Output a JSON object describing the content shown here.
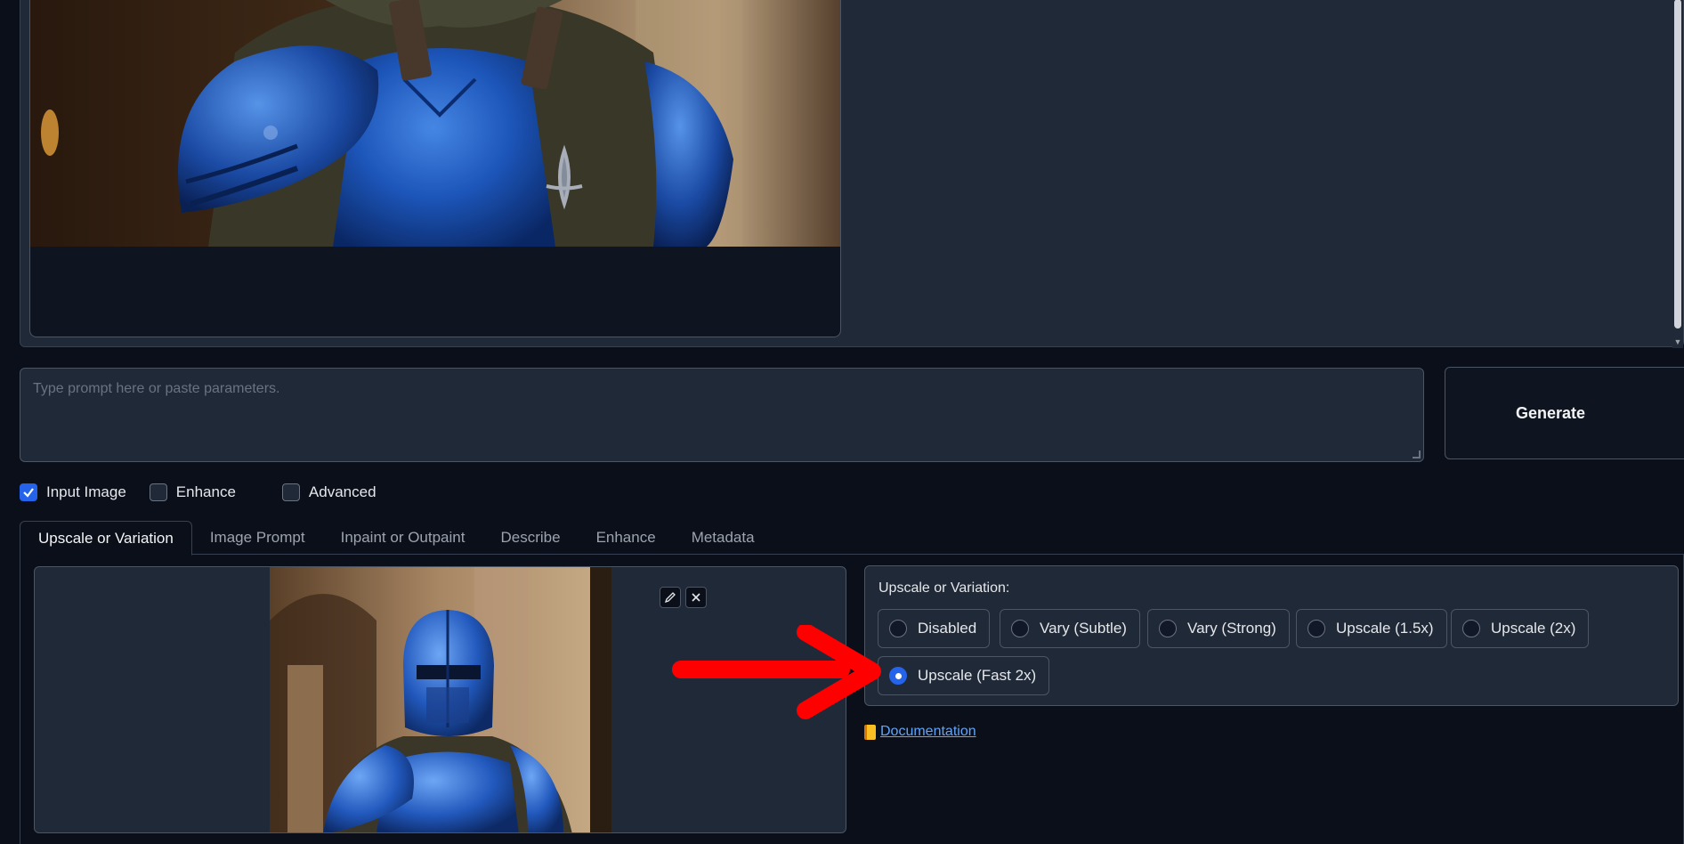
{
  "prompt": {
    "placeholder": "Type prompt here or paste parameters."
  },
  "generate_button": "Generate",
  "options": [
    {
      "label": "Input Image",
      "checked": true
    },
    {
      "label": "Enhance",
      "checked": false
    },
    {
      "label": "Advanced",
      "checked": false
    }
  ],
  "tabs": [
    {
      "label": "Upscale or Variation",
      "active": true
    },
    {
      "label": "Image Prompt",
      "active": false
    },
    {
      "label": "Inpaint or Outpaint",
      "active": false
    },
    {
      "label": "Describe",
      "active": false
    },
    {
      "label": "Enhance",
      "active": false
    },
    {
      "label": "Metadata",
      "active": false
    }
  ],
  "upscale": {
    "label": "Upscale or Variation:",
    "choices": [
      "Disabled",
      "Vary (Subtle)",
      "Vary (Strong)",
      "Upscale (1.5x)",
      "Upscale (2x)",
      "Upscale (Fast 2x)"
    ],
    "selected": "Upscale (Fast 2x)"
  },
  "documentation_link": "Documentation",
  "image_tools": [
    "edit-icon",
    "close-icon"
  ],
  "colors": {
    "background": "#0b0f19",
    "panel": "#1f2937",
    "accent": "#2563eb",
    "link": "#60a5fa",
    "annotation_arrow": "#ff0000"
  }
}
